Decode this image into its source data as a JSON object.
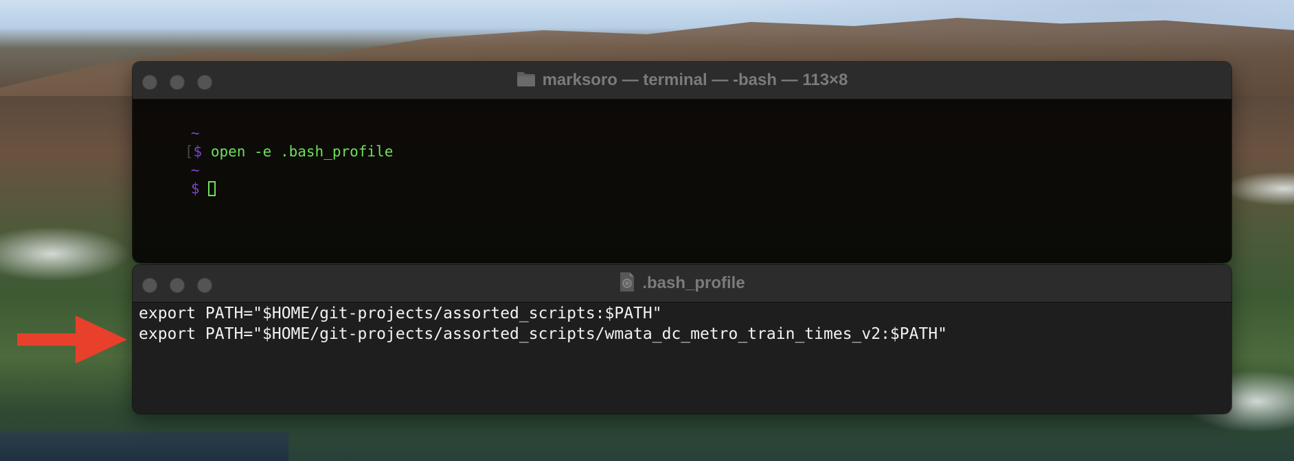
{
  "terminal": {
    "title": "marksoro — terminal — -bash — 113×8",
    "prompt_home": "~",
    "prompt_symbol": "$",
    "command": "open -e .bash_profile",
    "bracket_left": "[",
    "bracket_right": "]"
  },
  "editor": {
    "title": ".bash_profile",
    "lines": [
      "export PATH=\"$HOME/git-projects/assorted_scripts:$PATH\"",
      "export PATH=\"$HOME/git-projects/assorted_scripts/wmata_dc_metro_train_times_v2:$PATH\""
    ]
  },
  "colors": {
    "annotation_arrow": "#e8402a",
    "prompt": "#7a44c7",
    "command_text": "#6ee05a"
  },
  "icons": {
    "terminal_title_icon": "folder-icon",
    "editor_title_icon": "document-icon"
  }
}
